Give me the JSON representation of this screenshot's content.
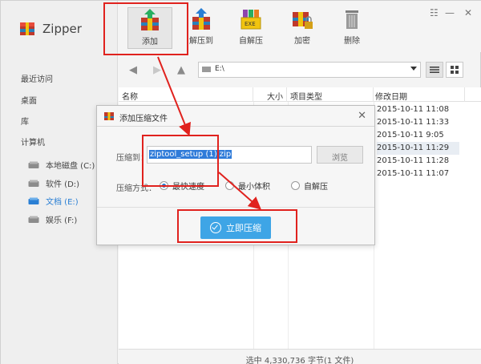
{
  "app": {
    "name": "Zipper"
  },
  "sidebar": {
    "items": [
      {
        "label": "最近访问"
      },
      {
        "label": "桌面"
      },
      {
        "label": "库"
      },
      {
        "label": "计算机"
      }
    ],
    "drives": [
      {
        "label": "本地磁盘 (C:)"
      },
      {
        "label": "软件 (D:)"
      },
      {
        "label": "文档 (E:)"
      },
      {
        "label": "娱乐 (F:)"
      }
    ]
  },
  "toolbar": {
    "add": "添加",
    "extract": "解压到",
    "self_extract": "自解压",
    "encrypt": "加密",
    "delete": "删除",
    "exe_badge": "EXE"
  },
  "window": {
    "menu": "☷",
    "minimize": "—",
    "close": "✕"
  },
  "address": {
    "path": "E:\\"
  },
  "filelist": {
    "columns": {
      "name": "名称",
      "size": "大小",
      "type": "项目类型",
      "modified": "修改日期"
    },
    "dates": [
      "2015-10-11 11:08",
      "2015-10-11 11:33",
      "2015-10-11 9:05",
      "2015-10-11 11:29",
      "2015-10-11 11:28",
      "2015-10-11 11:07"
    ]
  },
  "status": {
    "text": "选中 4,330,736 字节(1 文件)"
  },
  "dialog": {
    "title": "添加压缩文件",
    "close": "✕",
    "archive_label": "压缩到：",
    "archive_value": "ziptool_setup (1).zip",
    "browse": "浏览",
    "method_label": "压缩方式：",
    "options": {
      "fastest": "最快速度",
      "smallest": "最小体积",
      "sfx": "自解压"
    },
    "selected_option": "fastest",
    "compress_button": "立即压缩"
  },
  "colors": {
    "accent": "#3ea5e6",
    "highlight": "#e0221e",
    "selection": "#2f7bd9"
  }
}
